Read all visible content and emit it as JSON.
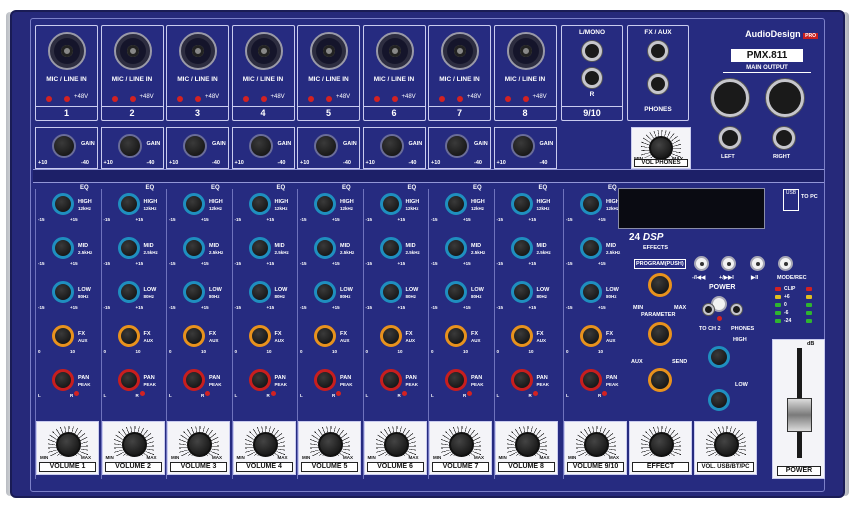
{
  "brand": {
    "logo": "AudioDesign",
    "sub": "PRO",
    "model": "PMX.811"
  },
  "channels": [
    {
      "num": "1",
      "vol": "VOLUME 1"
    },
    {
      "num": "2",
      "vol": "VOLUME 2"
    },
    {
      "num": "3",
      "vol": "VOLUME 3"
    },
    {
      "num": "4",
      "vol": "VOLUME 4"
    },
    {
      "num": "5",
      "vol": "VOLUME 5"
    },
    {
      "num": "6",
      "vol": "VOLUME 6"
    },
    {
      "num": "7",
      "vol": "VOLUME 7"
    },
    {
      "num": "8",
      "vol": "VOLUME 8"
    }
  ],
  "input_label": "MIC / LINE IN",
  "phantom": "+48V",
  "gain": {
    "label": "GAIN",
    "min": "+10",
    "max": "-40"
  },
  "eq": {
    "title": "EQ",
    "high": "HIGH",
    "high_freq": "12kHz",
    "mid": "MID",
    "mid_freq": "2.5kHz",
    "low": "LOW",
    "low_freq": "80Hz",
    "min": "-15",
    "max": "+15"
  },
  "fx": {
    "label": "FX",
    "aux": "AUX",
    "min": "0",
    "max": "10"
  },
  "pan": {
    "label": "PAN",
    "l": "L",
    "r": "R",
    "peak": "PEAK"
  },
  "ch910": {
    "top": "L/MONO",
    "r": "R",
    "num": "9/10",
    "vol": "VOLUME 9/10"
  },
  "fxaux_section": {
    "title": "FX / AUX",
    "phones": "PHONES",
    "vol_phones": "VOL PHONES",
    "min": "MIN",
    "max": "MAX"
  },
  "main_output": {
    "title": "MAIN OUTPUT",
    "left": "LEFT",
    "right": "RIGHT"
  },
  "usb": {
    "label": "USB",
    "to_pc": "TO PC"
  },
  "dsp": {
    "count": "24",
    "name": "DSP",
    "sub": "EFFECTS",
    "program": "PROGRAM(PUSH)",
    "parameter": "PARAMETER",
    "aux": "AUX",
    "send": "SEND",
    "effect_vol": "EFFECT"
  },
  "transport": {
    "prev": "-/I◀◀",
    "next": "+/▶▶I",
    "play": "▶II",
    "mode": "MODE/REC"
  },
  "power": {
    "label": "POWER",
    "fader": "POWER"
  },
  "to_ch2": "TO CH 2",
  "phones2": "PHONES",
  "master_eq": {
    "high": "HIGH",
    "low": "LOW"
  },
  "meter": {
    "clip": "CLIP",
    "p6": "+6",
    "zero": "0",
    "m6": "-6",
    "m24": "-24"
  },
  "vol_usb": "VOL. USB/BT/PC",
  "min": "MIN",
  "max": "MAX",
  "fader_scale": "dB",
  "colors": {
    "panel": "#262b80",
    "accent_teal": "#1f8fbf",
    "accent_orange": "#e8921d",
    "accent_red": "#c81e1e"
  }
}
